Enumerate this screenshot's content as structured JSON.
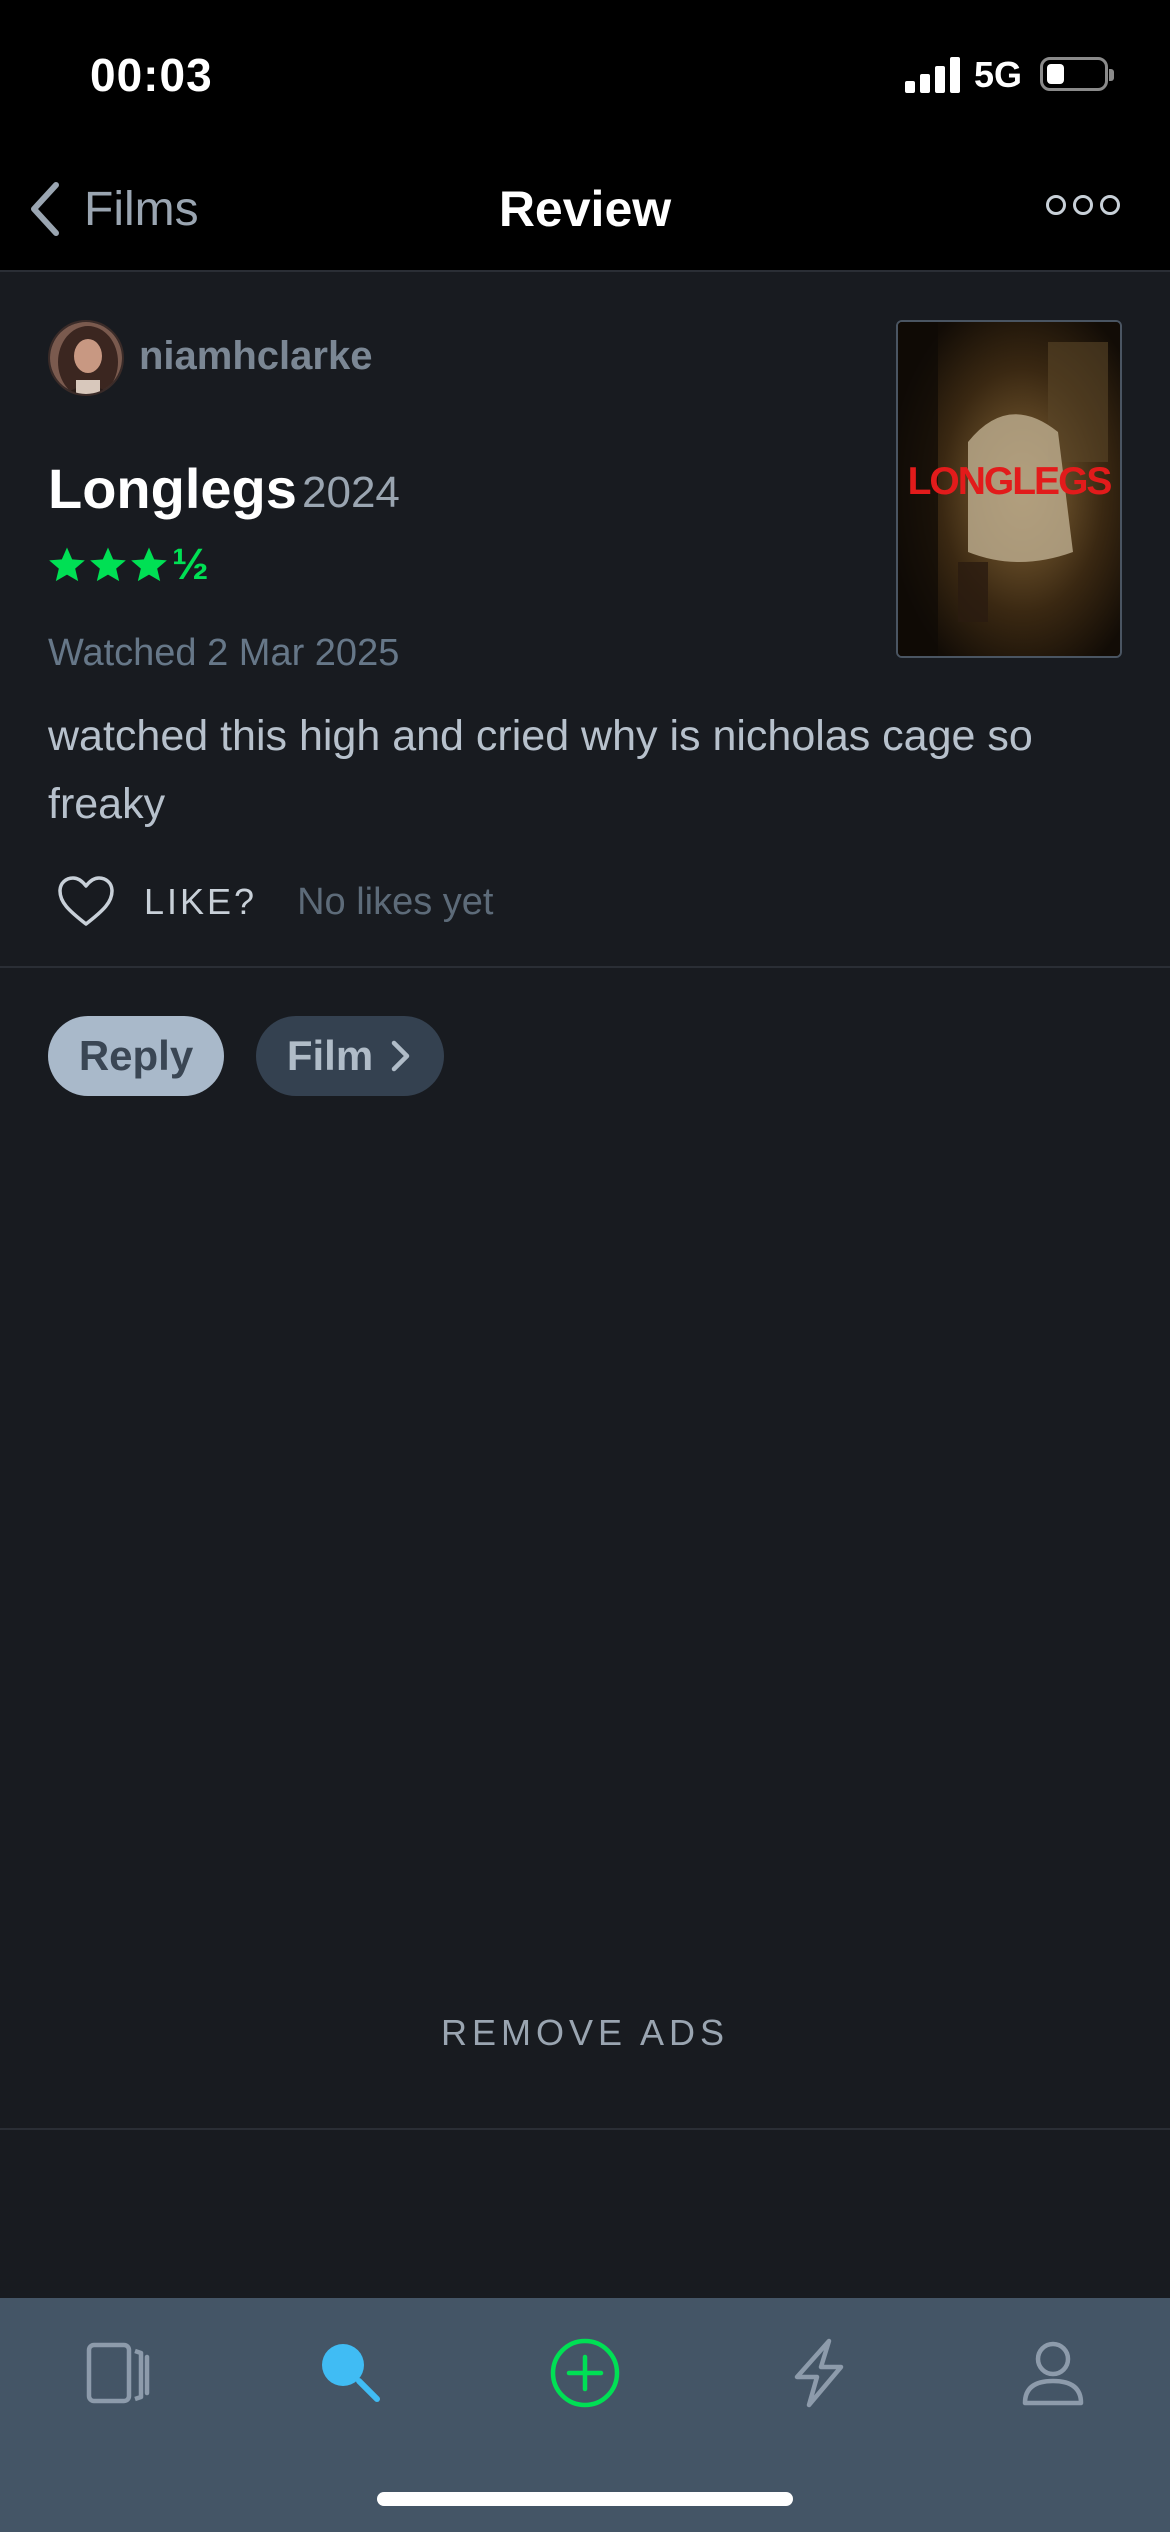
{
  "status_bar": {
    "time": "00:03",
    "network": "5G"
  },
  "nav": {
    "back_label": "Films",
    "title": "Review"
  },
  "review": {
    "username": "niamhclarke",
    "film_title": "Longlegs",
    "film_year": "2024",
    "rating": 3.5,
    "rating_half_glyph": "½",
    "watched": "Watched 2 Mar 2025",
    "text": "watched this high and cried why is nicholas cage so freaky",
    "like_label": "LIKE?",
    "likes_text": "No likes yet",
    "poster_title": "LONGLEGS"
  },
  "actions": {
    "reply_label": "Reply",
    "film_label": "Film"
  },
  "remove_ads_label": "REMOVE ADS",
  "tab_bar": {
    "items": [
      {
        "icon": "films-icon",
        "active": false
      },
      {
        "icon": "search-icon",
        "active": true
      },
      {
        "icon": "add-icon",
        "active": false
      },
      {
        "icon": "activity-icon",
        "active": false
      },
      {
        "icon": "profile-icon",
        "active": false
      }
    ]
  },
  "colors": {
    "accent_green": "#00e054",
    "accent_blue": "#40bcf4",
    "poster_red": "#e21b1b",
    "tab_bar_bg": "#445566",
    "page_bg": "#181b20"
  }
}
